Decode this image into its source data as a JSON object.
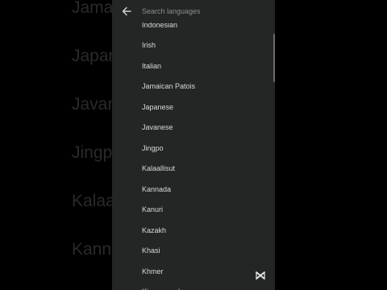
{
  "background_words": [
    "Jamai",
    "Japan",
    "Javan",
    "Jingp",
    "Kalaa",
    "Kanna"
  ],
  "search": {
    "placeholder": "Search languages"
  },
  "languages": [
    "Indonesian",
    "Irish",
    "Italian",
    "Jamaican Patois",
    "Japanese",
    "Javanese",
    "Jingpo",
    "Kalaallisut",
    "Kannada",
    "Kanuri",
    "Kazakh",
    "Khasi",
    "Khmer",
    "Kinyarwanda"
  ],
  "icons": {
    "back": "arrow-left-icon",
    "watermark": "capcut-logo-icon"
  },
  "colors": {
    "panel": "#242626",
    "text": "#d8d8d8",
    "placeholder": "#8b8d8d",
    "background_word": "#2a2a2a"
  }
}
